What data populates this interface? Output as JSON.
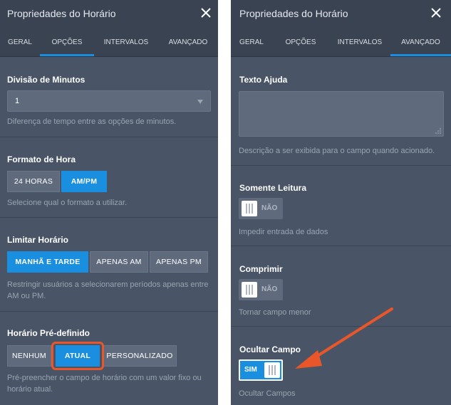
{
  "left_panel": {
    "title": "Propriedades do Horário",
    "tabs": [
      {
        "label": "GERAL"
      },
      {
        "label": "OPÇÕES"
      },
      {
        "label": "INTERVALOS"
      },
      {
        "label": "AVANÇADO"
      }
    ],
    "active_tab": "OPÇÕES",
    "minutes_division": {
      "label": "Divisão de Minutos",
      "value": "1",
      "description": "Diferença de tempo entre as opções de minutos."
    },
    "time_format": {
      "label": "Formato de Hora",
      "options": [
        "24 HORAS",
        "AM/PM"
      ],
      "selected": "AM/PM",
      "description": "Selecione qual o formato a utilizar."
    },
    "limit_time": {
      "label": "Limitar Horário",
      "options": [
        "MANHÃ E TARDE",
        "APENAS AM",
        "APENAS PM"
      ],
      "selected": "MANHÃ E TARDE",
      "description": "Restringir usuários a selecionarem períodos apenas entre AM ou PM."
    },
    "preset_time": {
      "label": "Horário Pré-definido",
      "options": [
        "NENHUM",
        "ATUAL",
        "PERSONALIZADO"
      ],
      "selected": "ATUAL",
      "description": "Pré-preencher o campo de horário com um valor fixo ou horário atual."
    }
  },
  "right_panel": {
    "title": "Propriedades do Horário",
    "tabs": [
      {
        "label": "GERAL"
      },
      {
        "label": "OPÇÕES"
      },
      {
        "label": "INTERVALOS"
      },
      {
        "label": "AVANÇADO"
      }
    ],
    "active_tab": "AVANÇADO",
    "help_text": {
      "label": "Texto Ajuda",
      "value": "",
      "description": "Descrição a ser exibida para o campo quando acionado."
    },
    "read_only": {
      "label": "Somente Leitura",
      "state": "NÃO",
      "description": "Impedir entrada de dados"
    },
    "shrink": {
      "label": "Comprimir",
      "state": "NÃO",
      "description": "Tornar campo menor"
    },
    "hide_field": {
      "label": "Ocultar Campo",
      "state": "SIM",
      "description": "Ocultar Campos"
    }
  },
  "colors": {
    "panel_bg": "#495567",
    "header_bg": "#3a4352",
    "accent": "#1a8fe0",
    "highlight": "#e8562a"
  },
  "icons": [
    "close-icon",
    "dropdown-caret-icon",
    "resize-grip-icon",
    "arrow-annotation"
  ]
}
